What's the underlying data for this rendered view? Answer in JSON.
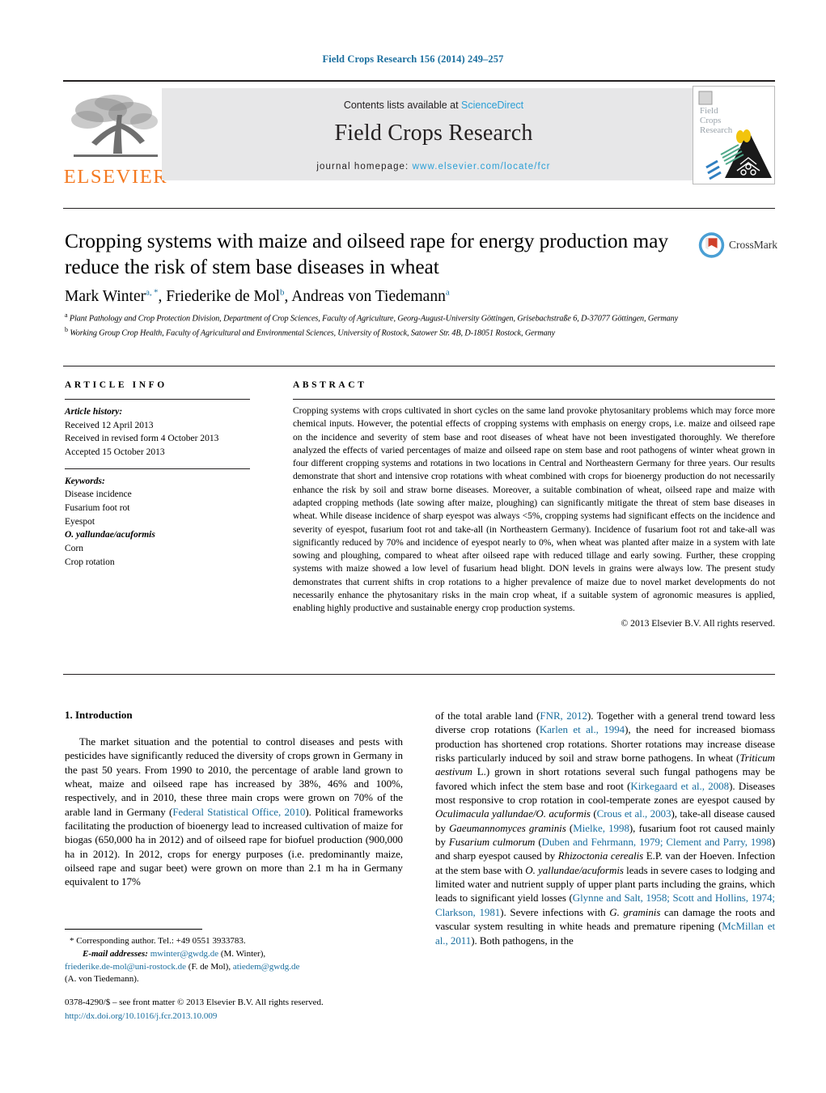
{
  "running_head": "Field Crops Research 156 (2014) 249–257",
  "masthead": {
    "contents_prefix": "Contents lists available at ",
    "sciencedirect": "ScienceDirect",
    "journal_title": "Field Crops Research",
    "homepage_label": "journal homepage:",
    "homepage_url": "www.elsevier.com/locate/fcr",
    "publisher_wordmark": "ELSEVIER",
    "cover_lines": [
      "Field",
      "Crops",
      "Research"
    ]
  },
  "article": {
    "title": "Cropping systems with maize and oilseed rape for energy production may reduce the risk of stem base diseases in wheat",
    "crossmark_label": "CrossMark",
    "authors_html": "Mark Winter<sup>a, *</sup>, Friederike de Mol<sup>b</sup>, Andreas von Tiedemann<sup>a</sup>",
    "affiliation_a": "Plant Pathology and Crop Protection Division, Department of Crop Sciences, Faculty of Agriculture, Georg-August-University Göttingen, Grisebachstraße 6, D-37077 Göttingen, Germany",
    "affiliation_b": "Working Group Crop Health, Faculty of Agricultural and Environmental Sciences, University of Rostock, Satower Str. 4B, D-18051 Rostock, Germany"
  },
  "article_info": {
    "heading": "ARTICLE INFO",
    "history_label": "Article history:",
    "history": [
      "Received 12 April 2013",
      "Received in revised form 4 October 2013",
      "Accepted 15 October 2013"
    ],
    "keywords_label": "Keywords:",
    "keywords": [
      "Disease incidence",
      "Fusarium foot rot",
      "Eyespot",
      "O. yallundae/acuformis",
      "Corn",
      "Crop rotation"
    ],
    "keyword_italic_index": 3
  },
  "abstract": {
    "heading": "ABSTRACT",
    "text": "Cropping systems with crops cultivated in short cycles on the same land provoke phytosanitary problems which may force more chemical inputs. However, the potential effects of cropping systems with emphasis on energy crops, i.e. maize and oilseed rape on the incidence and severity of stem base and root diseases of wheat have not been investigated thoroughly. We therefore analyzed the effects of varied percentages of maize and oilseed rape on stem base and root pathogens of winter wheat grown in four different cropping systems and rotations in two locations in Central and Northeastern Germany for three years. Our results demonstrate that short and intensive crop rotations with wheat combined with crops for bioenergy production do not necessarily enhance the risk by soil and straw borne diseases. Moreover, a suitable combination of wheat, oilseed rape and maize with adapted cropping methods (late sowing after maize, ploughing) can significantly mitigate the threat of stem base diseases in wheat. While disease incidence of sharp eyespot was always <5%, cropping systems had significant effects on the incidence and severity of eyespot, fusarium foot rot and take-all (in Northeastern Germany). Incidence of fusarium foot rot and take-all was significantly reduced by 70% and incidence of eyespot nearly to 0%, when wheat was planted after maize in a system with late sowing and ploughing, compared to wheat after oilseed rape with reduced tillage and early sowing. Further, these cropping systems with maize showed a low level of fusarium head blight. DON levels in grains were always low. The present study demonstrates that current shifts in crop rotations to a higher prevalence of maize due to novel market developments do not necessarily enhance the phytosanitary risks in the main crop wheat, if a suitable system of agronomic measures is applied, enabling highly productive and sustainable energy crop production systems.",
    "copyright": "© 2013 Elsevier B.V. All rights reserved."
  },
  "introduction": {
    "heading": "1. Introduction",
    "left_paragraph_html": "The market situation and the potential to control diseases and pests with pesticides have significantly reduced the diversity of crops grown in Germany in the past 50 years. From 1990 to 2010, the percentage of arable land grown to wheat, maize and oilseed rape has increased by 38%, 46% and 100%, respectively, and in 2010, these three main crops were grown on 70% of the arable land in Germany (<span class=\"ref\">Federal Statistical Office, 2010</span>). Political frameworks facilitating the production of bioenergy lead to increased cultivation of maize for biogas (650,000 ha in 2012) and of oilseed rape for biofuel production (900,000 ha in 2012). In 2012, crops for energy purposes (i.e. predominantly maize, oilseed rape and sugar beet) were grown on more than 2.1 m ha in Germany equivalent to 17%",
    "right_paragraph_html": "of the total arable land (<span class=\"ref\">FNR, 2012</span>). Together with a general trend toward less diverse crop rotations (<span class=\"ref\">Karlen et al., 1994</span>), the need for increased biomass production has shortened crop rotations. Shorter rotations may increase disease risks particularly induced by soil and straw borne pathogens. In wheat (<span class=\"ital\">Triticum aestivum</span> L.) grown in short rotations several such fungal pathogens may be favored which infect the stem base and root (<span class=\"ref\">Kirkegaard et al., 2008</span>). Diseases most responsive to crop rotation in cool-temperate zones are eyespot caused by <span class=\"ital\">Oculimacula yallundae/O. acuformis</span> (<span class=\"ref\">Crous et al., 2003</span>), take-all disease caused by <span class=\"ital\">Gaeumannomyces graminis</span> (<span class=\"ref\">Mielke, 1998</span>), fusarium foot rot caused mainly by <span class=\"ital\">Fusarium culmorum</span> (<span class=\"ref\">Duben and Fehrmann, 1979; Clement and Parry, 1998</span>) and sharp eyespot caused by <span class=\"ital\">Rhizoctonia cerealis</span> E.P. van der Hoeven. Infection at the stem base with <span class=\"ital\">O. yallundae/acuformis</span> leads in severe cases to lodging and limited water and nutrient supply of upper plant parts including the grains, which leads to significant yield losses (<span class=\"ref\">Glynne and Salt, 1958; Scott and Hollins, 1974; Clarkson, 1981</span>). Severe infections with <span class=\"ital\">G. graminis</span> can damage the roots and vascular system resulting in white heads and premature ripening (<span class=\"ref\">McMillan et al., 2011</span>). Both pathogens, in the"
  },
  "footnotes": {
    "corresponding_html": "* Corresponding author. Tel.: +49 0551 3933783.",
    "email_line_html": "<span class=\"em-label\">E-mail addresses:</span> <span class=\"mail\">mwinter@gwdg.de</span> (M. Winter),",
    "email_line2_html": "<span class=\"mail\">friederike.de-mol@uni-rostock.de</span> (F. de Mol), <span class=\"mail\">atiedem@gwdg.de</span>",
    "email_line3_html": "(A. von Tiedemann)."
  },
  "frontmatter": {
    "line1": "0378-4290/$ – see front matter © 2013 Elsevier B.V. All rights reserved.",
    "doi": "http://dx.doi.org/10.1016/j.fcr.2013.10.009"
  },
  "colors": {
    "link_blue": "#1a6e9e",
    "sciencedirect_blue": "#2a9fd6",
    "elsevier_orange": "#f47920",
    "banner_gray": "#e7e7e8"
  }
}
